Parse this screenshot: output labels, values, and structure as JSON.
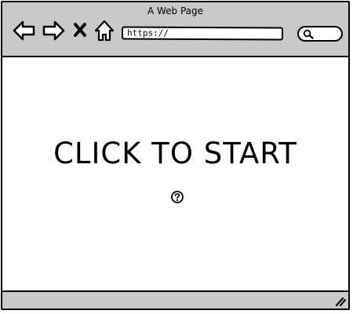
{
  "window": {
    "title": "A Web Page"
  },
  "toolbar": {
    "back_icon": "back-arrow-icon",
    "forward_icon": "forward-arrow-icon",
    "stop_icon": "close-icon",
    "home_icon": "home-icon",
    "url": "https://",
    "search_icon": "search-icon"
  },
  "content": {
    "headline": "CLICK TO START",
    "help_icon": "help-icon"
  },
  "statusbar": {
    "resize_icon": "resize-grip-icon"
  },
  "colors": {
    "chrome": "#c9c9c9",
    "background": "#ffffff",
    "stroke": "#000000"
  }
}
